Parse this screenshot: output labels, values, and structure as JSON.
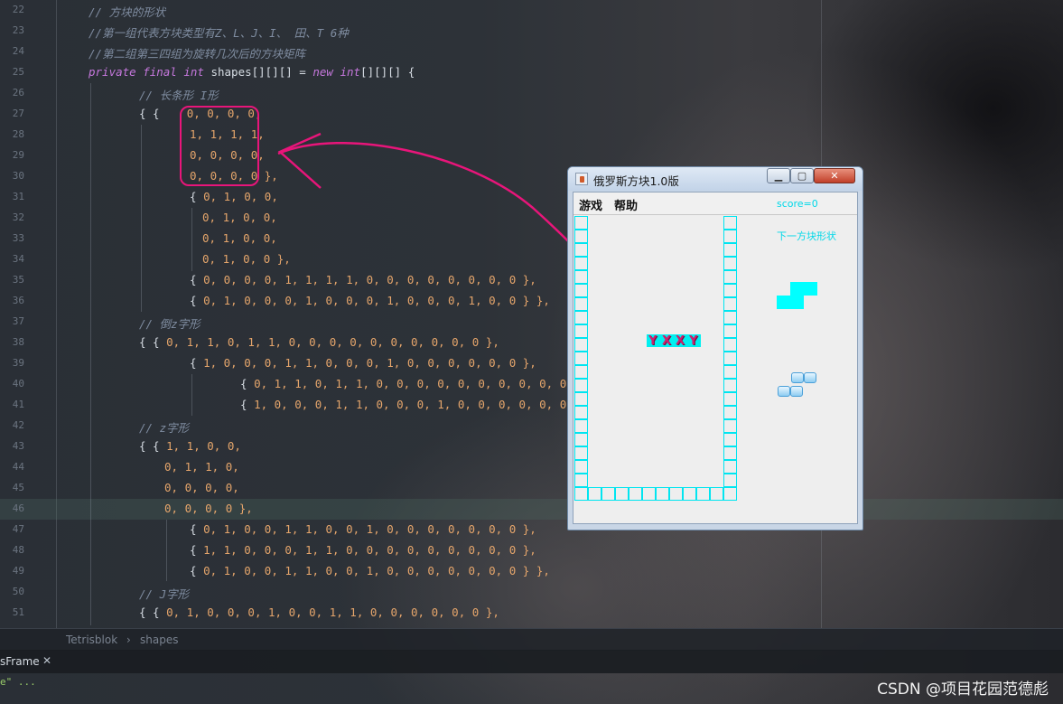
{
  "editor": {
    "lines": [
      {
        "n": "22",
        "indent": 98,
        "tokens": [
          {
            "t": "// 方块的形状",
            "c": "c-comment"
          }
        ]
      },
      {
        "n": "23",
        "indent": 98,
        "tokens": [
          {
            "t": "//第一组代表方块类型有Z、L、J、I、 田、T 6种",
            "c": "c-comment"
          }
        ]
      },
      {
        "n": "24",
        "indent": 98,
        "tokens": [
          {
            "t": "//第二组第三四组为旋转几次后的方块矩阵",
            "c": "c-comment"
          }
        ]
      },
      {
        "n": "25",
        "indent": 98,
        "tokens": [
          {
            "t": "private final int ",
            "c": "c-kw"
          },
          {
            "t": "shapes[][][] = ",
            "c": "c-id"
          },
          {
            "t": "new int",
            "c": "c-kw"
          },
          {
            "t": "[][][] {",
            "c": "c-id"
          }
        ]
      },
      {
        "n": "26",
        "indent": 154,
        "tokens": [
          {
            "t": "// 长条形 I形",
            "c": "c-comment"
          }
        ]
      },
      {
        "n": "27",
        "indent": 154,
        "tokens": [
          {
            "t": "{ {    ",
            "c": "c-id"
          },
          {
            "t": "0, 0, 0, 0,",
            "c": "c-num"
          }
        ]
      },
      {
        "n": "28",
        "indent": 210,
        "tokens": [
          {
            "t": "1, 1, 1, 1,",
            "c": "c-num"
          }
        ]
      },
      {
        "n": "29",
        "indent": 210,
        "tokens": [
          {
            "t": "0, 0, 0, 0,",
            "c": "c-num"
          }
        ]
      },
      {
        "n": "30",
        "indent": 210,
        "tokens": [
          {
            "t": "0, 0, 0, 0 },",
            "c": "c-num"
          }
        ]
      },
      {
        "n": "31",
        "indent": 210,
        "tokens": [
          {
            "t": "{ ",
            "c": "c-id"
          },
          {
            "t": "0, 1, 0, 0,",
            "c": "c-num"
          }
        ]
      },
      {
        "n": "32",
        "indent": 224,
        "tokens": [
          {
            "t": "0, 1, 0, 0,",
            "c": "c-num"
          }
        ]
      },
      {
        "n": "33",
        "indent": 224,
        "tokens": [
          {
            "t": "0, 1, 0, 0,",
            "c": "c-num"
          }
        ]
      },
      {
        "n": "34",
        "indent": 224,
        "tokens": [
          {
            "t": "0, 1, 0, 0 },",
            "c": "c-num"
          }
        ]
      },
      {
        "n": "35",
        "indent": 210,
        "tokens": [
          {
            "t": "{ ",
            "c": "c-id"
          },
          {
            "t": "0, 0, 0, 0, 1, 1, 1, 1, 0, 0, 0, 0, 0, 0, 0, 0 },",
            "c": "c-num"
          }
        ]
      },
      {
        "n": "36",
        "indent": 210,
        "tokens": [
          {
            "t": "{ ",
            "c": "c-id"
          },
          {
            "t": "0, 1, 0, 0, 0, 1, 0, 0, 0, 1, 0, 0, 0, 1, 0, 0 } },",
            "c": "c-num"
          }
        ]
      },
      {
        "n": "37",
        "indent": 154,
        "tokens": [
          {
            "t": "// 倒z字形",
            "c": "c-comment"
          }
        ]
      },
      {
        "n": "38",
        "indent": 154,
        "tokens": [
          {
            "t": "{ { ",
            "c": "c-id"
          },
          {
            "t": "0, 1, 1, 0, 1, 1, 0, 0, 0, 0, 0, 0, 0, 0, 0, 0 },",
            "c": "c-num"
          }
        ]
      },
      {
        "n": "39",
        "indent": 210,
        "tokens": [
          {
            "t": "{ ",
            "c": "c-id"
          },
          {
            "t": "1, 0, 0, 0, 1, 1, 0, 0, 0, 1, 0, 0, 0, 0, 0, 0 },",
            "c": "c-num"
          }
        ]
      },
      {
        "n": "40",
        "indent": 266,
        "tokens": [
          {
            "t": "{ ",
            "c": "c-id"
          },
          {
            "t": "0, 1, 1, 0, 1, 1, 0, 0, 0, 0, 0, 0, 0, 0, 0, 0 },",
            "c": "c-num"
          }
        ]
      },
      {
        "n": "41",
        "indent": 266,
        "tokens": [
          {
            "t": "{ ",
            "c": "c-id"
          },
          {
            "t": "1, 0, 0, 0, 1, 1, 0, 0, 0, 1, 0, 0, 0, 0, 0, 0 } },",
            "c": "c-num"
          }
        ]
      },
      {
        "n": "42",
        "indent": 154,
        "tokens": [
          {
            "t": "// z字形",
            "c": "c-comment"
          }
        ]
      },
      {
        "n": "43",
        "indent": 154,
        "tokens": [
          {
            "t": "{ { ",
            "c": "c-id"
          },
          {
            "t": "1, 1, 0, 0,",
            "c": "c-num"
          }
        ]
      },
      {
        "n": "44",
        "indent": 182,
        "tokens": [
          {
            "t": "0, 1, 1, 0,",
            "c": "c-num"
          }
        ]
      },
      {
        "n": "45",
        "indent": 182,
        "tokens": [
          {
            "t": "0, 0, 0, 0,",
            "c": "c-num"
          }
        ]
      },
      {
        "n": "46",
        "indent": 182,
        "tokens": [
          {
            "t": "0, 0, 0, 0 },",
            "c": "c-num"
          }
        ],
        "active": true
      },
      {
        "n": "47",
        "indent": 210,
        "tokens": [
          {
            "t": "{ ",
            "c": "c-id"
          },
          {
            "t": "0, 1, 0, 0, 1, 1, 0, 0, 1, 0, 0, 0, 0, 0, 0, 0 },",
            "c": "c-num"
          }
        ]
      },
      {
        "n": "48",
        "indent": 210,
        "tokens": [
          {
            "t": "{ ",
            "c": "c-id"
          },
          {
            "t": "1, 1, 0, 0, 0, 1, 1, 0, 0, 0, 0, 0, 0, 0, 0, 0 },",
            "c": "c-num"
          }
        ]
      },
      {
        "n": "49",
        "indent": 210,
        "tokens": [
          {
            "t": "{ ",
            "c": "c-id"
          },
          {
            "t": "0, 1, 0, 0, 1, 1, 0, 0, 1, 0, 0, 0, 0, 0, 0, 0 } },",
            "c": "c-num"
          }
        ]
      },
      {
        "n": "50",
        "indent": 154,
        "tokens": [
          {
            "t": "// J字形",
            "c": "c-comment"
          }
        ]
      },
      {
        "n": "51",
        "indent": 154,
        "tokens": [
          {
            "t": "{ { ",
            "c": "c-id"
          },
          {
            "t": "0, 1, 0, 0, 0, 1, 0, 0, 1, 1, 0, 0, 0, 0, 0, 0 },",
            "c": "c-num"
          }
        ]
      }
    ]
  },
  "breadcrumb": {
    "file": "Tetrisblok",
    "sep": "›",
    "symbol": "shapes"
  },
  "tabbar": {
    "tab": "sFrame",
    "close": "✕"
  },
  "console": {
    "text": "e\" ..."
  },
  "watermark": "CSDN @项目花园范德彪",
  "game_window": {
    "title": "俄罗斯方块1.0版",
    "menu": [
      "游戏",
      "帮助"
    ],
    "score_text": "score=0",
    "next_label": "下一方块形状",
    "falling_text": [
      "Y",
      "X",
      "X",
      "Y"
    ],
    "colors": {
      "grid": "#00e5f0",
      "piece": "#00ffff",
      "annotation": "#e8157a"
    }
  }
}
